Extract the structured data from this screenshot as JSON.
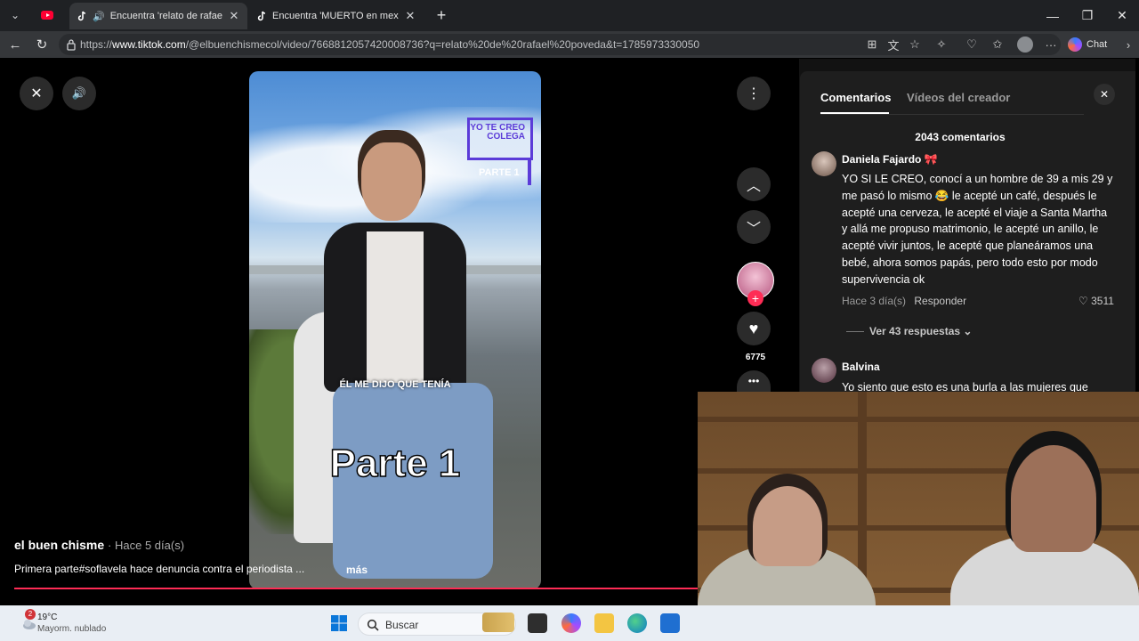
{
  "browser": {
    "tabs": [
      {
        "title": "Encuentra 'relato de rafael po",
        "active": true
      },
      {
        "title": "Encuentra 'MUERTO en mexico en",
        "active": false
      }
    ],
    "url_prefix": "https://",
    "url_host": "www.tiktok.com",
    "url_path": "/@elbuenchismecol/video/7668812057420008736?q=relato%20de%20rafael%20poveda&t=1785973330050",
    "chat_label": "Chat"
  },
  "video": {
    "badge_text": "YO TE CREO COLEGA",
    "badge_sub": "PARTE 1",
    "caption": "ÉL ME DIJO QUE TENÍA",
    "big_text": "Parte 1",
    "like_count": "6775",
    "author": "el buen chisme",
    "posted": "· Hace 5 día(s)",
    "description": "Primera parte#soflavela hace denuncia contra el periodista ...",
    "more_label": "más"
  },
  "comments_panel": {
    "tab_comments": "Comentarios",
    "tab_creator": "Vídeos del creador",
    "count_label": "2043 comentarios",
    "comments": [
      {
        "user": "Daniela Fajardo 🎀",
        "text": "YO SI LE CREO, conocí a un hombre de 39 a mis 29 y me pasó lo mismo 😂 le acepté un café, después le acepté una cerveza, le acepté el viaje a Santa Martha y allá me propuso matrimonio, le acepté un anillo, le acepté vivir juntos, le acepté que planeáramos una bebé, ahora somos papás, pero todo esto por modo supervivencia ok",
        "time": "Hace 3 día(s)",
        "reply_label": "Responder",
        "likes": "3511",
        "replies_label": "Ver 43 respuestas"
      },
      {
        "user": "Balvina",
        "text": "Yo siento que esto es una burla a las mujeres que"
      }
    ]
  },
  "taskbar": {
    "weather_badge": "2",
    "weather_temp": "19°C",
    "weather_desc": "Mayorm. nublado",
    "search_placeholder": "Buscar"
  },
  "colors": {
    "accent": "#fe2c55",
    "badge_purple": "#5b3bd8"
  }
}
